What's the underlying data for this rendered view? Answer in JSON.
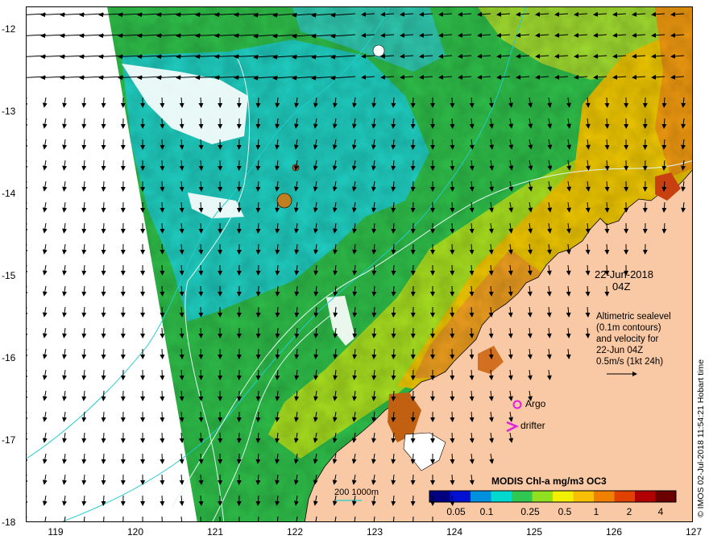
{
  "map": {
    "lon_ticks": [
      "119",
      "120",
      "121",
      "122",
      "123",
      "124",
      "125",
      "126",
      "127"
    ],
    "lat_ticks": [
      "-12",
      "-13",
      "-14",
      "-15",
      "-16",
      "-17",
      "-18"
    ],
    "lon_range": [
      118.62,
      127.0
    ],
    "lat_range": [
      -11.92,
      -18.0
    ],
    "land_color": "#f8c9a4",
    "no_data_color": "#ffffff",
    "contour_color": "#e0f8f0",
    "isobath_color": "#22cccc",
    "date_line1": "22-Jun-2018",
    "date_line2": "04Z",
    "info_lines": [
      "Altimetric sealevel",
      "(0.1m contours)",
      "and velocity for",
      "22-Jun 04Z",
      "0.5m/s (1kt 24h)"
    ],
    "argo_label": "Argo",
    "argo_color": "#e020e0",
    "drifter_label": "drifter",
    "drifter_color": "#e020e0",
    "colorbar_title": "MODIS Chl-a mg/m3 OC3",
    "colorbar_ticks": [
      "0.05",
      "0.1",
      "0.25",
      "0.5",
      "1",
      "2",
      "4"
    ],
    "colorbar_colors": [
      "#000080",
      "#0010d0",
      "#0090e0",
      "#00d8d0",
      "#30c850",
      "#90e020",
      "#f0f000",
      "#f8c000",
      "#f08000",
      "#e04000",
      "#b00000",
      "#6a0000"
    ],
    "contour_legend": "200  1000m",
    "watermark": "© IMOS 02-Jul-2018 11:54:21 Hobart time"
  }
}
